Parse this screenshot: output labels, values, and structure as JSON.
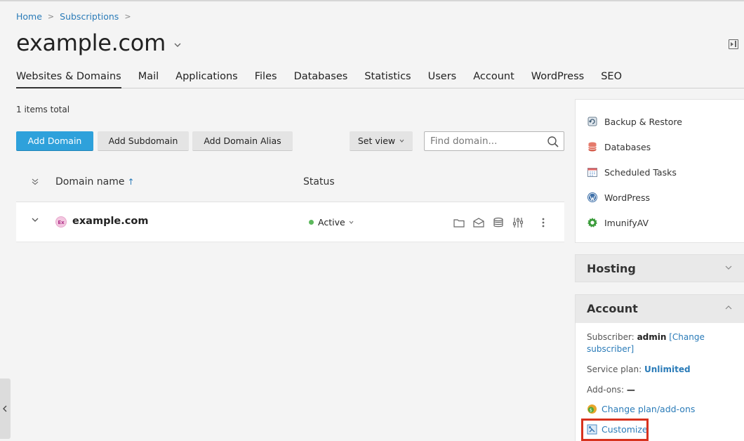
{
  "breadcrumb": {
    "home": "Home",
    "subscriptions": "Subscriptions",
    "separator": ">"
  },
  "page": {
    "title": "example.com"
  },
  "tabs": [
    {
      "label": "Websites & Domains"
    },
    {
      "label": "Mail"
    },
    {
      "label": "Applications"
    },
    {
      "label": "Files"
    },
    {
      "label": "Databases"
    },
    {
      "label": "Statistics"
    },
    {
      "label": "Users"
    },
    {
      "label": "Account"
    },
    {
      "label": "WordPress"
    },
    {
      "label": "SEO"
    }
  ],
  "list": {
    "items_total": "1 items total"
  },
  "toolbar": {
    "add_domain": "Add Domain",
    "add_subdomain": "Add Subdomain",
    "add_domain_alias": "Add Domain Alias",
    "set_view": "Set view",
    "search_placeholder": "Find domain..."
  },
  "table": {
    "col_domain": "Domain name",
    "col_status": "Status",
    "sort_indicator": "↑",
    "rows": [
      {
        "favicon": "Ex",
        "domain": "example.com",
        "status": "Active"
      }
    ]
  },
  "tools": [
    {
      "label": "Backup & Restore",
      "icon": "backup-icon"
    },
    {
      "label": "Databases",
      "icon": "database-icon"
    },
    {
      "label": "Scheduled Tasks",
      "icon": "calendar-icon"
    },
    {
      "label": "WordPress",
      "icon": "wordpress-icon"
    },
    {
      "label": "ImunifyAV",
      "icon": "imunify-icon"
    }
  ],
  "hosting": {
    "title": "Hosting"
  },
  "account": {
    "title": "Account",
    "subscriber_label": "Subscriber:",
    "subscriber_value": "admin",
    "change_subscriber": "[Change subscriber]",
    "service_plan_label": "Service plan:",
    "service_plan_value": "Unlimited",
    "addons_label": "Add-ons:",
    "addons_value": "—",
    "change_plan": "Change plan/add-ons",
    "customize": "Customize"
  },
  "colors": {
    "primary": "#2ea1db",
    "link": "#2a7bb8",
    "active": "#5cb85c",
    "highlight": "#d8321e"
  }
}
